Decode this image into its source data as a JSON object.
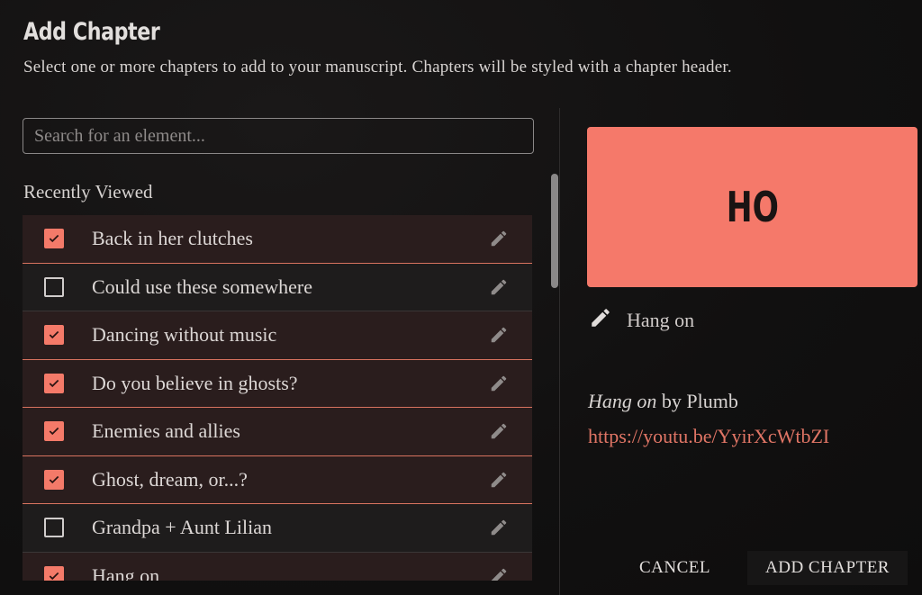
{
  "dialog": {
    "title": "Add Chapter",
    "subtitle": "Select one or more chapters to add to your manuscript. Chapters will be styled with a chapter header."
  },
  "search": {
    "placeholder": "Search for an element...",
    "value": ""
  },
  "list": {
    "section_label": "Recently Viewed",
    "items": [
      {
        "label": "Back in her clutches",
        "checked": true
      },
      {
        "label": "Could use these somewhere",
        "checked": false
      },
      {
        "label": "Dancing without music",
        "checked": true
      },
      {
        "label": "Do you believe in ghosts?",
        "checked": true
      },
      {
        "label": "Enemies and allies",
        "checked": true
      },
      {
        "label": "Ghost, dream, or...?",
        "checked": true
      },
      {
        "label": "Grandpa + Aunt Lilian",
        "checked": false
      },
      {
        "label": "Hang on",
        "checked": true
      }
    ]
  },
  "preview": {
    "cover_initials": "HO",
    "cover_color": "#f5796a",
    "name": "Hang on",
    "credit_title": "Hang on",
    "credit_by": " by Plumb",
    "link": "https://youtu.be/YyirXcWtbZI"
  },
  "actions": {
    "cancel_label": "CANCEL",
    "add_label": "ADD CHAPTER"
  },
  "icons": {
    "edit": "pencil-icon",
    "check": "checkmark-icon"
  },
  "colors": {
    "accent": "#f47a69",
    "checked_row_bg": "#2a1d1d",
    "link": "#e07565"
  }
}
